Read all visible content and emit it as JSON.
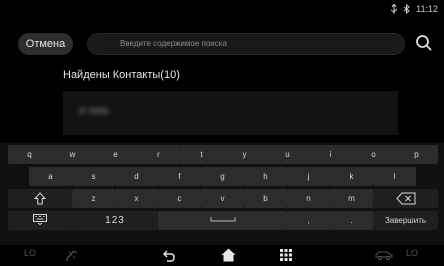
{
  "status": {
    "time": "11:12",
    "icons": [
      "usb-icon",
      "bluetooth-icon"
    ]
  },
  "search": {
    "cancel_label": "Отмена",
    "placeholder": "Введите содержимое поиска"
  },
  "results": {
    "title": "Найдены Контакты(10)",
    "blurred_text": "● ●●●"
  },
  "keyboard": {
    "row1": [
      "q",
      "w",
      "e",
      "r",
      "t",
      "y",
      "u",
      "i",
      "o",
      "p"
    ],
    "row2": [
      "a",
      "s",
      "d",
      "f",
      "g",
      "h",
      "j",
      "k",
      "l"
    ],
    "row3": [
      "z",
      "x",
      "c",
      "v",
      "b",
      "n",
      "m"
    ],
    "num_label": "123",
    "done_label": "Завершить",
    "comma": ",",
    "period": "."
  },
  "navbar": {
    "left_label": "LO",
    "right_label": "LO",
    "icons": [
      "climate-fan-icon",
      "back-icon",
      "home-icon",
      "apps-grid-icon",
      "car-icon"
    ]
  }
}
